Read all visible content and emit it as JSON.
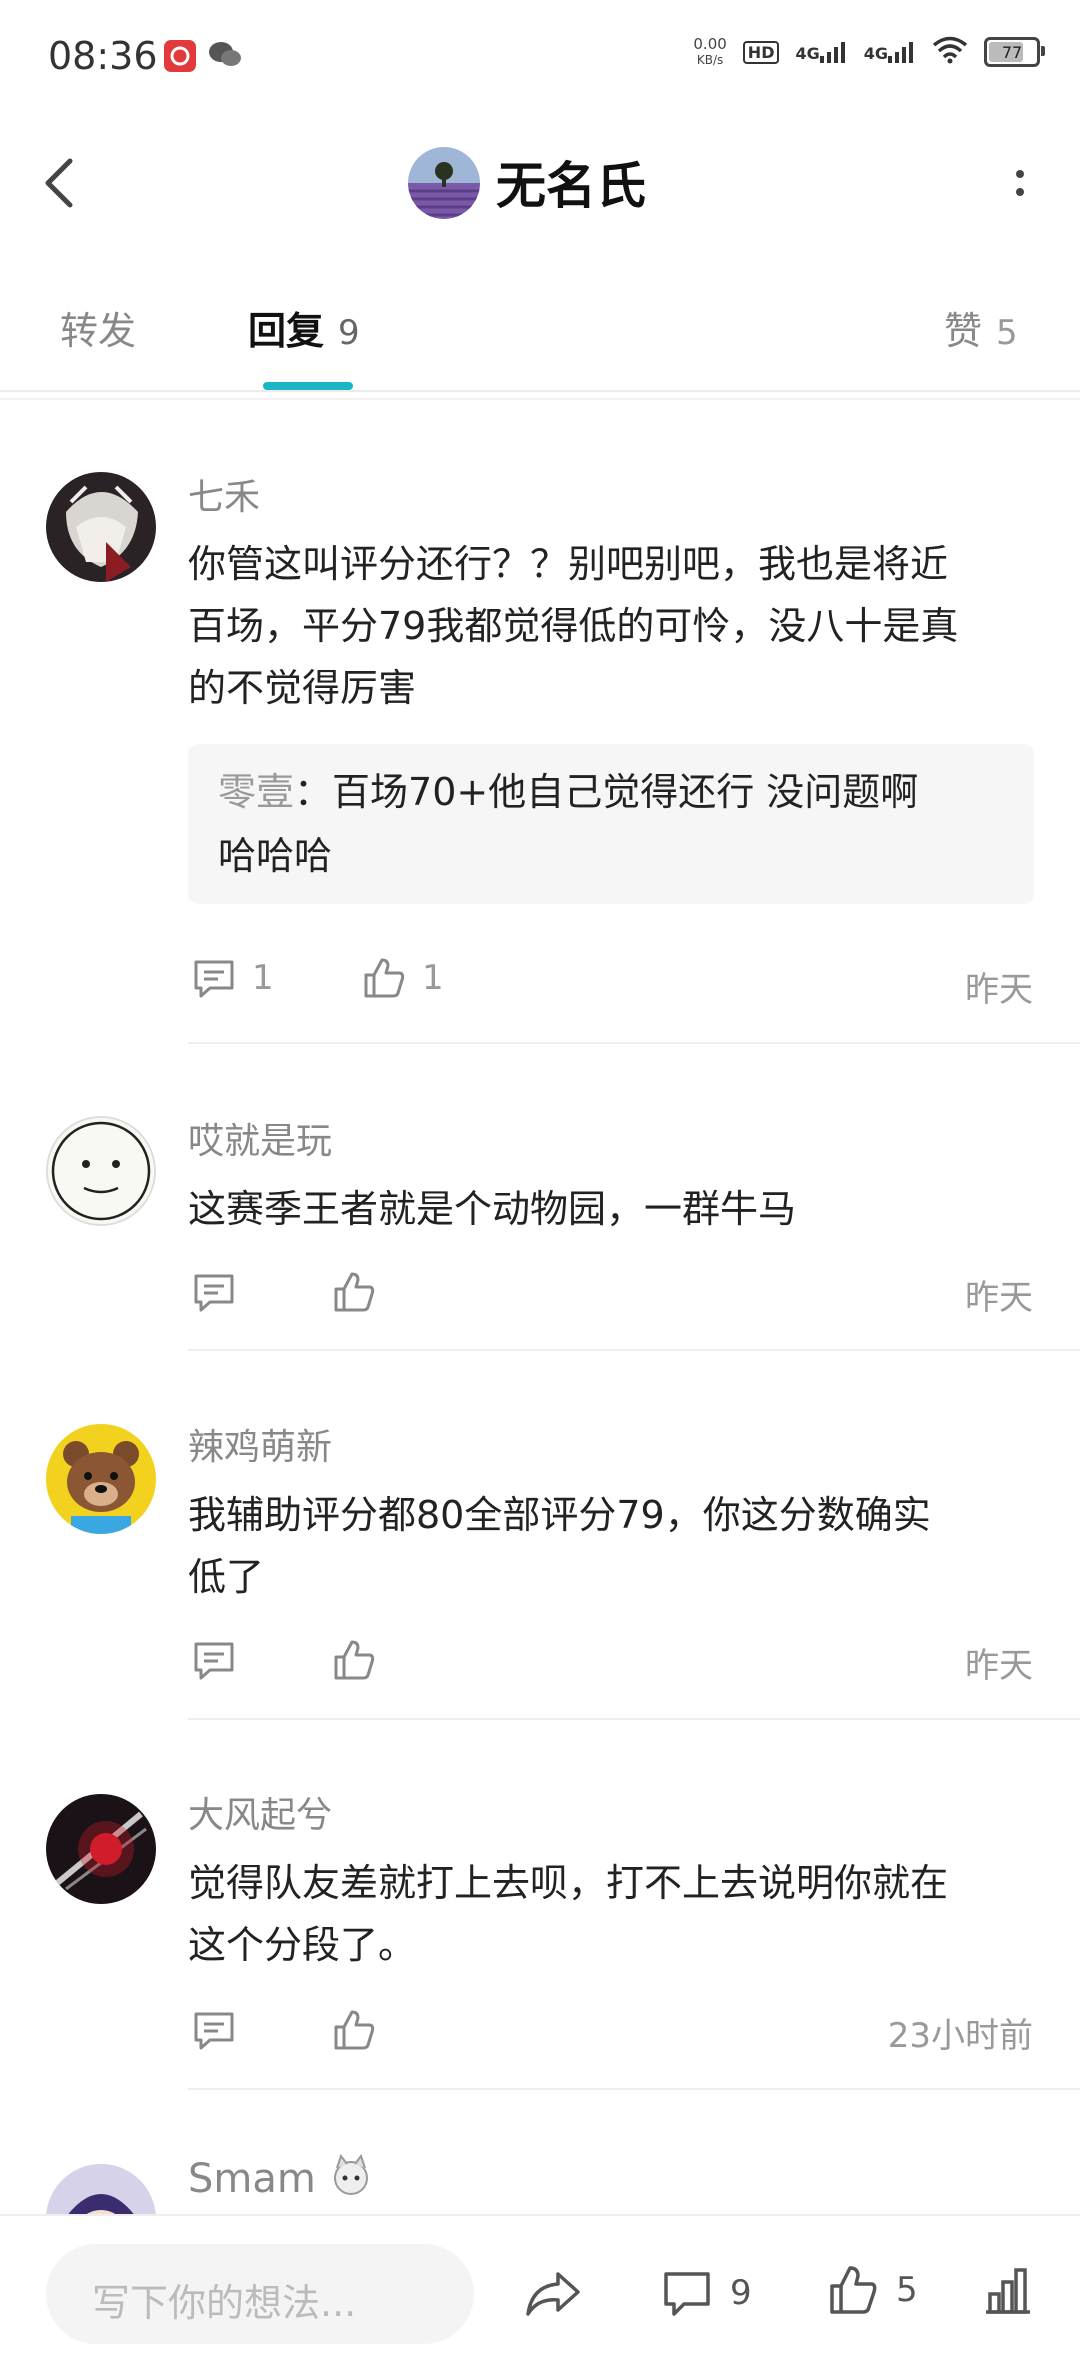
{
  "status": {
    "time": "08:36",
    "net_speed": "0.00",
    "net_unit": "KB/s",
    "hd": "HD",
    "sig1": "4G",
    "sig2": "4G",
    "battery": "77"
  },
  "header": {
    "title": "无名氏"
  },
  "tabs": {
    "forward": "转发",
    "reply": "回复",
    "reply_count": "9",
    "like": "赞",
    "like_count": "5"
  },
  "comments": [
    {
      "author": "七禾",
      "lines": [
        "你管这叫评分还行？？别吧别吧，我也是将近",
        "百场，平分79我都觉得低的可怜，没八十是真",
        "的不觉得厉害"
      ],
      "quote_author": "零壹",
      "quote_sep": "：",
      "quote_line1": "百场70+他自己觉得还行 没问题啊",
      "quote_line2": "哈哈哈",
      "reply_count": "1",
      "like_count": "1",
      "time": "昨天"
    },
    {
      "author": "哎就是玩",
      "lines": [
        "这赛季王者就是个动物园，一群牛马"
      ],
      "time": "昨天"
    },
    {
      "author": "辣鸡萌新",
      "lines": [
        "我辅助评分都80全部评分79，你这分数确实",
        "低了"
      ],
      "time": "昨天"
    },
    {
      "author": "大风起兮",
      "lines": [
        "觉得队友差就打上去呗，打不上去说明你就在",
        "这个分段了。"
      ],
      "time": "23小时前"
    },
    {
      "author": "Smam"
    }
  ],
  "bottom": {
    "placeholder": "写下你的想法...",
    "comment_count": "9",
    "like_count": "5"
  },
  "colors": {
    "accent": "#1bb5c4",
    "netease": "#e23a3a"
  }
}
